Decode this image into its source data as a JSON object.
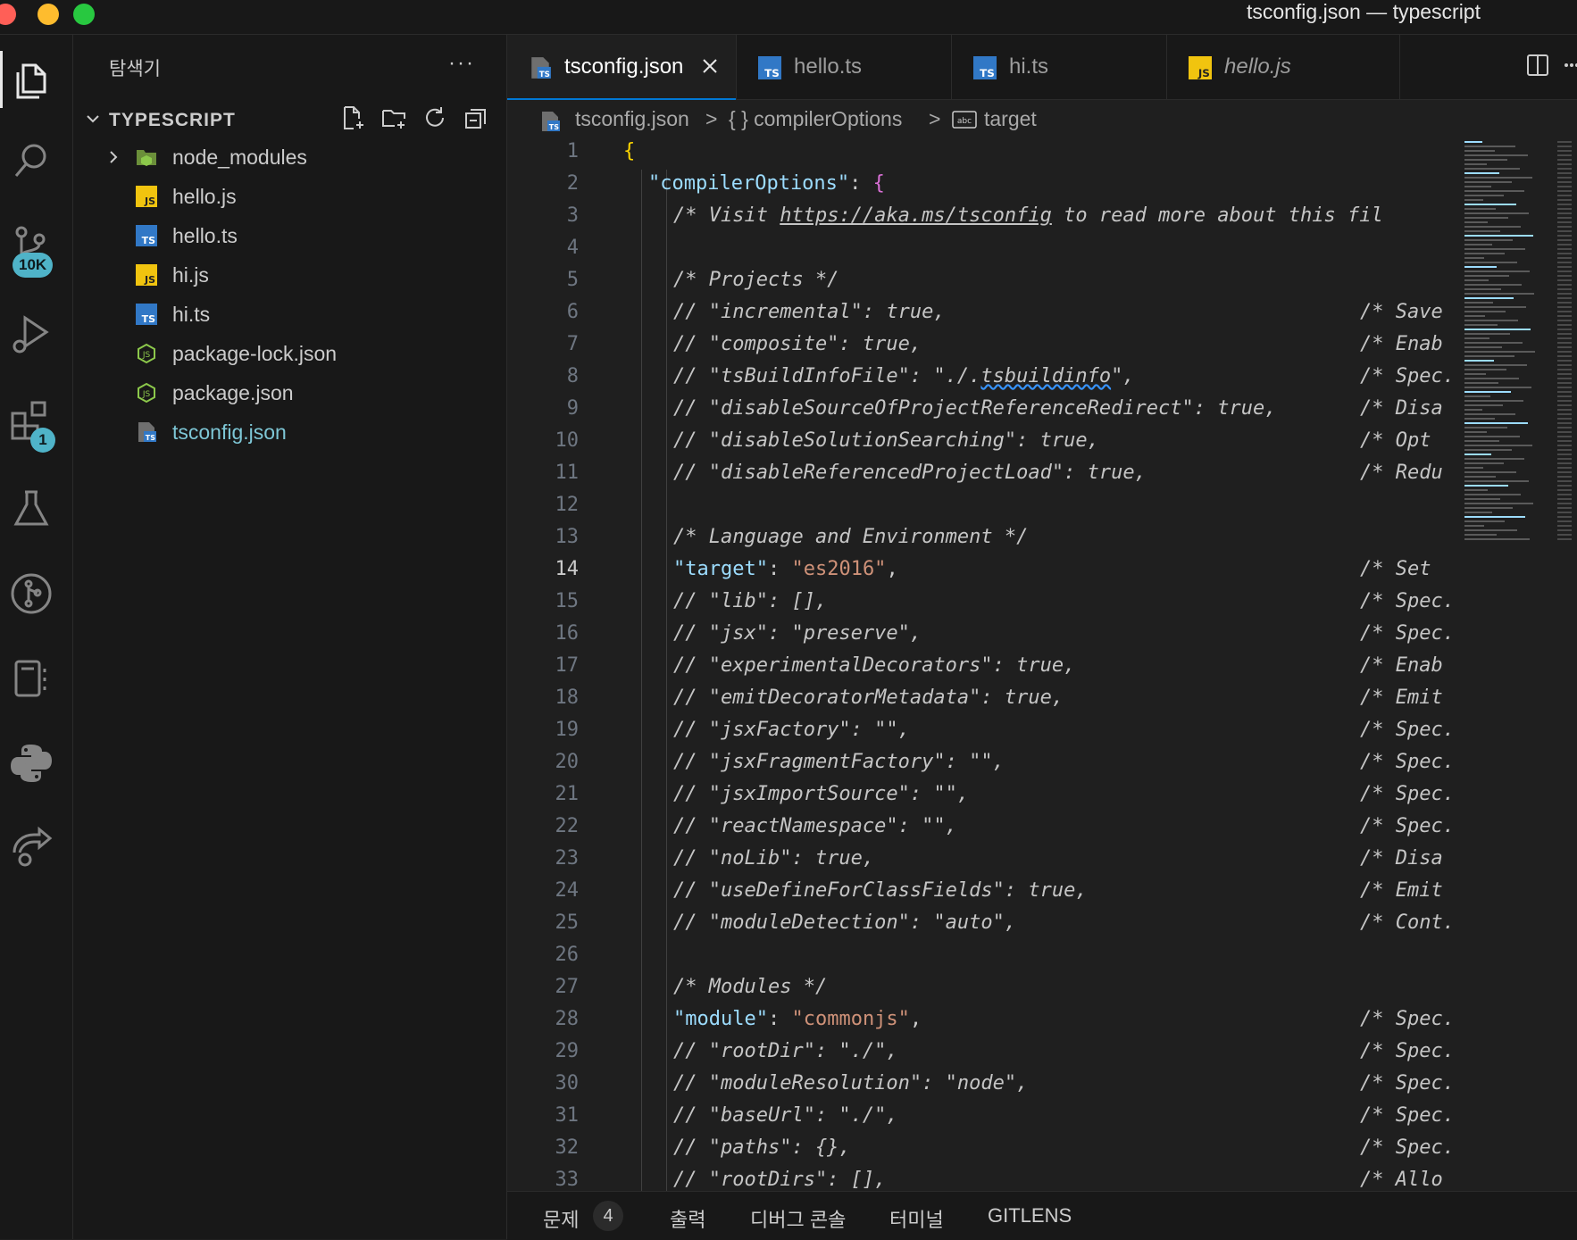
{
  "window": {
    "title": "tsconfig.json — typescript"
  },
  "activitybar": {
    "source_control_badge": "10K",
    "extensions_badge": "1"
  },
  "sidebar": {
    "title": "탐색기",
    "more": "···",
    "section": "TYPESCRIPT",
    "files": [
      {
        "name": "node_modules",
        "icon": "folder-icon"
      },
      {
        "name": "hello.js",
        "icon": "js-file-icon"
      },
      {
        "name": "hello.ts",
        "icon": "ts-file-icon"
      },
      {
        "name": "hi.js",
        "icon": "js-file-icon"
      },
      {
        "name": "hi.ts",
        "icon": "ts-file-icon"
      },
      {
        "name": "package-lock.json",
        "icon": "nodejs-icon"
      },
      {
        "name": "package.json",
        "icon": "nodejs-icon"
      },
      {
        "name": "tsconfig.json",
        "icon": "tsconfig-icon"
      }
    ]
  },
  "tabs": [
    {
      "label": "tsconfig.json"
    },
    {
      "label": "hello.ts"
    },
    {
      "label": "hi.ts"
    },
    {
      "label": "hello.js"
    }
  ],
  "breadcrumb": {
    "file": "tsconfig.json",
    "sep": ">",
    "path1": "{ } compilerOptions",
    "path2": "target"
  },
  "code": {
    "current_line": 14,
    "lines": [
      {
        "n": "1",
        "text": "{"
      },
      {
        "n": "2",
        "text": "\"compilerOptions\": {"
      },
      {
        "n": "3",
        "text_a": "/* Visit ",
        "url": "https://aka.ms/tsconfig",
        "text_b": " to read more about this fil"
      },
      {
        "n": "4",
        "text": ""
      },
      {
        "n": "5",
        "text": "/* Projects */"
      },
      {
        "n": "6",
        "text": "// \"incremental\": true,",
        "tail": "/* Save"
      },
      {
        "n": "7",
        "text": "// \"composite\": true,",
        "tail": "/* Enab"
      },
      {
        "n": "8",
        "text_a": "// \"tsBuildInfoFile\": \"./.",
        "squig": "tsbuildinfo",
        "text_b": "\",",
        "tail": "/* Spec."
      },
      {
        "n": "9",
        "text": "// \"disableSourceOfProjectReferenceRedirect\": true,",
        "tail": "/* Disa"
      },
      {
        "n": "10",
        "text": "// \"disableSolutionSearching\": true,",
        "tail": "/* Opt"
      },
      {
        "n": "11",
        "text": "// \"disableReferencedProjectLoad\": true,",
        "tail": "/* Redu"
      },
      {
        "n": "12",
        "text": ""
      },
      {
        "n": "13",
        "text": "/* Language and Environment */"
      },
      {
        "n": "14",
        "key": "\"target\"",
        "colon": ": ",
        "val": "\"es2016\"",
        "comma": ",",
        "tail": "/* Set"
      },
      {
        "n": "15",
        "text": "// \"lib\": [],",
        "tail": "/* Spec."
      },
      {
        "n": "16",
        "text": "// \"jsx\": \"preserve\",",
        "tail": "/* Spec."
      },
      {
        "n": "17",
        "text": "// \"experimentalDecorators\": true,",
        "tail": "/* Enab"
      },
      {
        "n": "18",
        "text": "// \"emitDecoratorMetadata\": true,",
        "tail": "/* Emit"
      },
      {
        "n": "19",
        "text": "// \"jsxFactory\": \"\",",
        "tail": "/* Spec."
      },
      {
        "n": "20",
        "text": "// \"jsxFragmentFactory\": \"\",",
        "tail": "/* Spec."
      },
      {
        "n": "21",
        "text": "// \"jsxImportSource\": \"\",",
        "tail": "/* Spec."
      },
      {
        "n": "22",
        "text": "// \"reactNamespace\": \"\",",
        "tail": "/* Spec."
      },
      {
        "n": "23",
        "text": "// \"noLib\": true,",
        "tail": "/* Disa"
      },
      {
        "n": "24",
        "text": "// \"useDefineForClassFields\": true,",
        "tail": "/* Emit"
      },
      {
        "n": "25",
        "text": "// \"moduleDetection\": \"auto\",",
        "tail": "/* Cont."
      },
      {
        "n": "26",
        "text": ""
      },
      {
        "n": "27",
        "text": "/* Modules */"
      },
      {
        "n": "28",
        "key": "\"module\"",
        "colon": ": ",
        "val": "\"commonjs\"",
        "comma": ",",
        "tail": "/* Spec."
      },
      {
        "n": "29",
        "text": "// \"rootDir\": \"./\",",
        "tail": "/* Spec."
      },
      {
        "n": "30",
        "text": "// \"moduleResolution\": \"node\",",
        "tail": "/* Spec."
      },
      {
        "n": "31",
        "text": "// \"baseUrl\": \"./\",",
        "tail": "/* Spec."
      },
      {
        "n": "32",
        "text": "// \"paths\": {},",
        "tail": "/* Spec."
      },
      {
        "n": "33",
        "text": "// \"rootDirs\": [],",
        "tail": "/* Allo"
      }
    ]
  },
  "panel": {
    "problems": "문제",
    "problems_count": "4",
    "output": "출력",
    "debug_console": "디버그 콘솔",
    "terminal": "터미널",
    "gitlens": "GITLENS"
  },
  "colors": {
    "accent": "#0078d4",
    "badge": "#4fb3c8",
    "ts_blue": "#3178c6",
    "js_yellow": "#f1c40f",
    "node_green": "#8cc84b"
  }
}
